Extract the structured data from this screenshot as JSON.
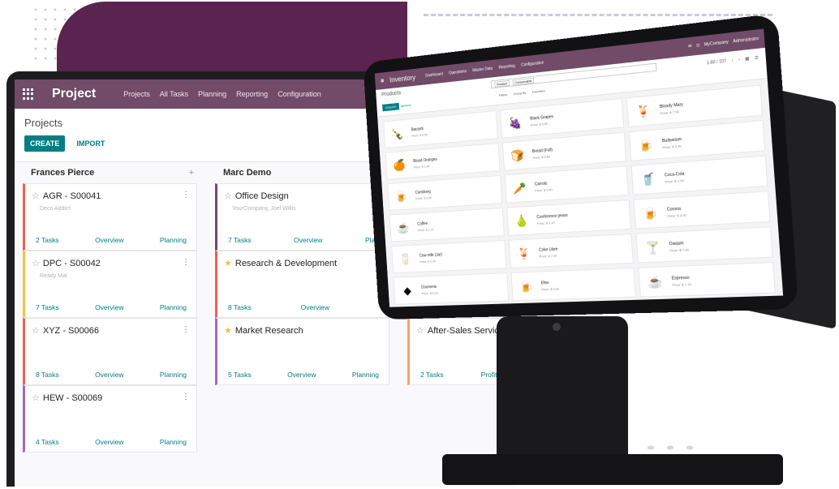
{
  "colors": {
    "brand_purple": "#714b67",
    "accent_teal": "#017e84",
    "backdrop_plum": "#5b2350",
    "star_gold": "#f3c13a"
  },
  "laptop": {
    "app_name": "Project",
    "menu": [
      "Projects",
      "All Tasks",
      "Planning",
      "Reporting",
      "Configuration"
    ],
    "breadcrumb": "Projects",
    "create_label": "CREATE",
    "import_label": "IMPORT",
    "columns": [
      {
        "title": "Frances Pierce",
        "add_icon": "+",
        "cards": [
          {
            "title": "AGR - S00041",
            "subtitle": "Deco Addict",
            "tasks": "2 Tasks",
            "overview": "Overview",
            "planning": "Planning",
            "starred": false,
            "color": "#f06050"
          },
          {
            "title": "DPC - S00042",
            "subtitle": "Ready Mat",
            "tasks": "7 Tasks",
            "overview": "Overview",
            "planning": "Planning",
            "starred": false,
            "color": "#f4c542"
          },
          {
            "title": "XYZ - S00066",
            "subtitle": "",
            "tasks": "8 Tasks",
            "overview": "Overview",
            "planning": "Planning",
            "starred": false,
            "color": "#f06050"
          },
          {
            "title": "HEW - S00069",
            "subtitle": "",
            "tasks": "4 Tasks",
            "overview": "Overview",
            "planning": "Planning",
            "starred": false,
            "color": "#a567c4"
          }
        ]
      },
      {
        "title": "Marc Demo",
        "cards": [
          {
            "title": "Office Design",
            "subtitle": "YourCompany, Joel Willis",
            "tasks": "7 Tasks",
            "overview": "Overview",
            "planning": "Plan",
            "starred": false,
            "color": "#714b67"
          },
          {
            "title": "Research & Development",
            "subtitle": "",
            "tasks": "8 Tasks",
            "overview": "Overview",
            "planning": "",
            "starred": true,
            "color": "#f06050"
          },
          {
            "title": "Market Research",
            "subtitle": "",
            "tasks": "5 Tasks",
            "overview": "Overview",
            "planning": "Planning",
            "starred": true,
            "color": "#a567c4"
          }
        ]
      },
      {
        "title": "",
        "cards": [
          {
            "title": "After-Sales Services",
            "subtitle": "",
            "tasks": "2 Tasks",
            "overview": "Profit",
            "planning": "",
            "starred": false,
            "color": "#f4a460"
          }
        ]
      }
    ]
  },
  "tablet": {
    "app_name": "Inventory",
    "menu": [
      "Dashboard",
      "Operations",
      "Master Data",
      "Reporting",
      "Configuration"
    ],
    "company": "MyCompany",
    "user": "Administrator",
    "breadcrumb": "Products",
    "search_facets": [
      "Product",
      "Consumable"
    ],
    "create_label": "CREATE",
    "import_label": "IMPORT",
    "filters": [
      "Filters",
      "Group By",
      "Favorites"
    ],
    "pager": "1-80 / 107",
    "products": [
      {
        "name": "Bacardi",
        "price": "Price: $ 0.00",
        "icon": "bottle-icon"
      },
      {
        "name": "Black Grapes",
        "price": "Price: $ 4.80",
        "icon": "grapes-icon"
      },
      {
        "name": "Bloody Mary",
        "price": "Price: $ 7.00",
        "icon": "drink-icon"
      },
      {
        "name": "Blood Oranges",
        "price": "Price: $ 1.80",
        "icon": "orange-icon"
      },
      {
        "name": "Bread (Full)",
        "price": "Price: $ 0.80",
        "icon": "bread-icon"
      },
      {
        "name": "Budweiser",
        "price": "Price: $ 3.40",
        "icon": "beer-icon"
      },
      {
        "name": "Carlsberg",
        "price": "Price: $ 3.00",
        "icon": "beer-logo-icon"
      },
      {
        "name": "Carrots",
        "price": "Price: $ 0.40",
        "icon": "carrot-icon"
      },
      {
        "name": "Coca-Cola",
        "price": "Price: $ 1.00",
        "icon": "cola-icon"
      },
      {
        "name": "Coffee",
        "price": "Price: $ 1.70",
        "icon": "coffee-icon"
      },
      {
        "name": "Conference pears",
        "price": "Price: $ 1.10",
        "icon": "pear-icon"
      },
      {
        "name": "Corona",
        "price": "Price: $ 3.00",
        "icon": "beer-logo-icon"
      },
      {
        "name": "Cow milk (Jar)",
        "price": "Price: $ 0.00",
        "icon": "milk-icon"
      },
      {
        "name": "Coke Libre",
        "price": "Price: $ 7.00",
        "icon": "drink-icon"
      },
      {
        "name": "Daiquiri",
        "price": "Price: $ 7.00",
        "icon": "glass-icon"
      },
      {
        "name": "Doumene",
        "price": "Price: $ 0.00",
        "icon": "brand-icon"
      },
      {
        "name": "Efes",
        "price": "Price: $ 0.00",
        "icon": "beer-logo-icon"
      },
      {
        "name": "Espresso",
        "price": "Price: $ 1.70",
        "icon": "coffee-icon"
      }
    ]
  }
}
